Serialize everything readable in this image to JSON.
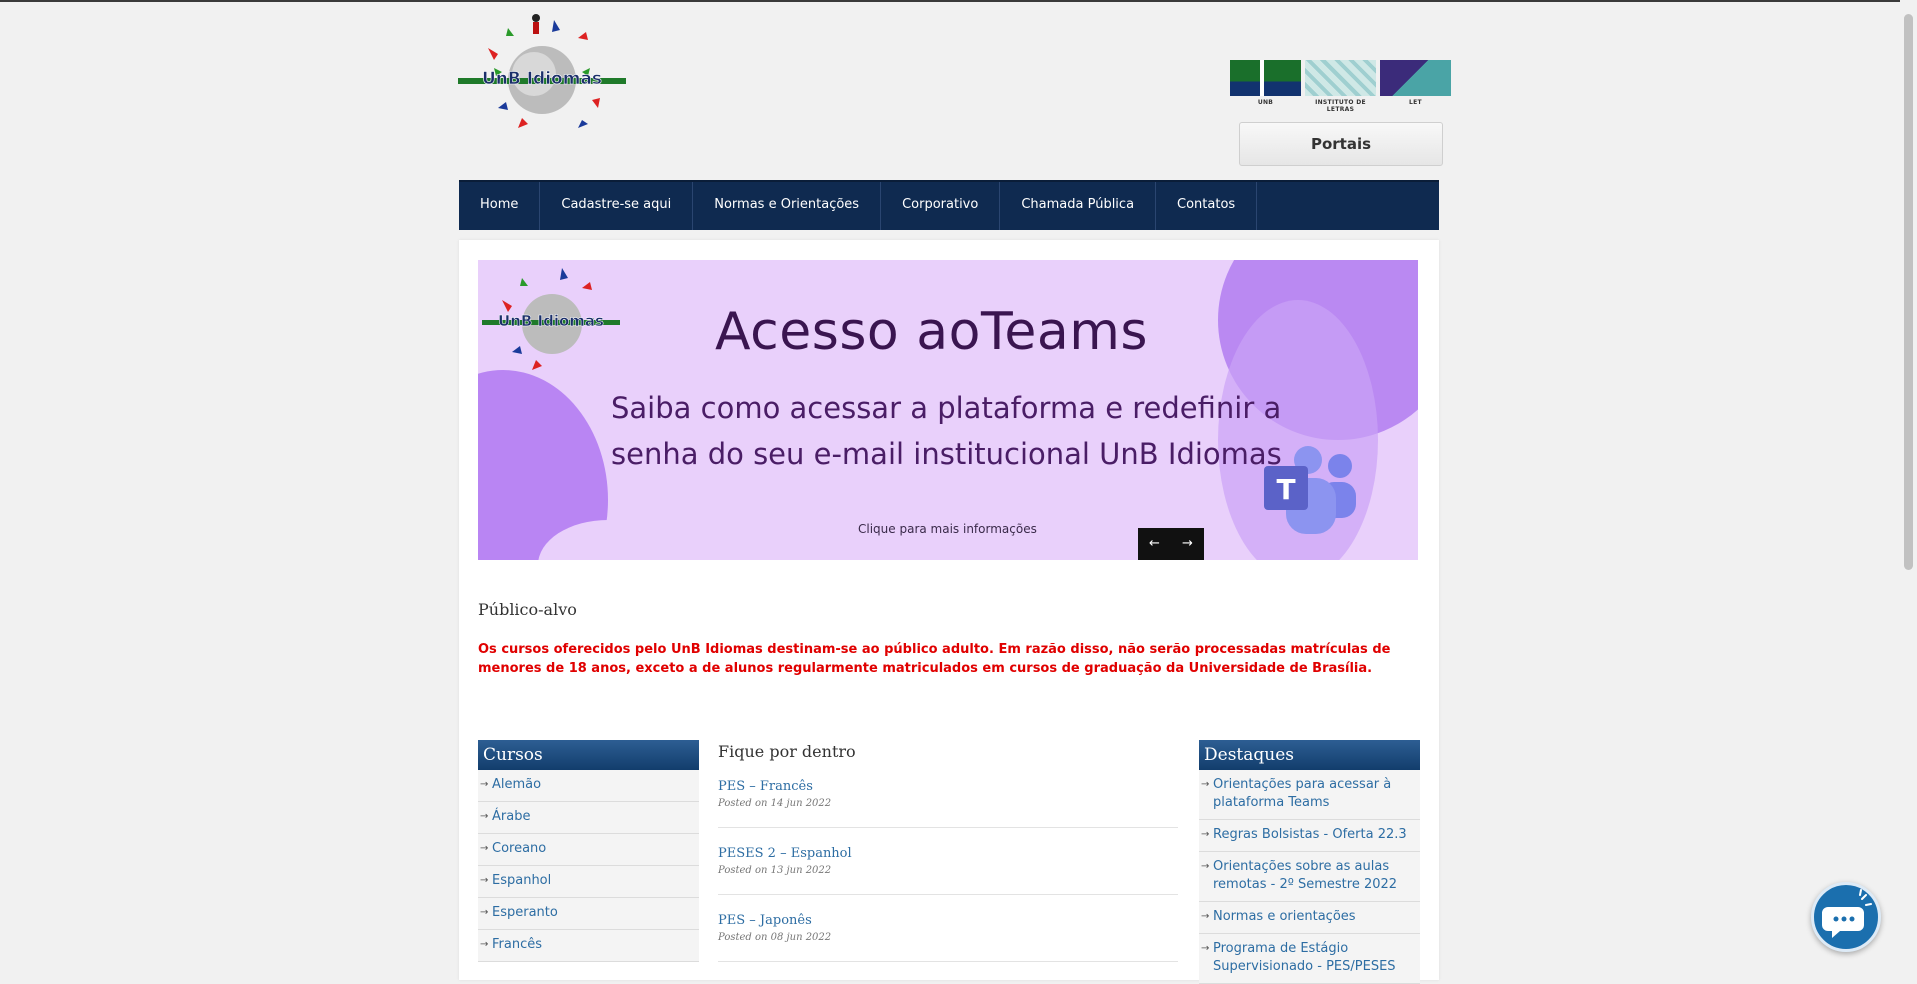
{
  "header": {
    "logo_text": "UnB Idiomas",
    "partner_captions": [
      "UNB",
      "INSTITUTO DE LETRAS",
      "LET"
    ],
    "portais_label": "Portais"
  },
  "nav": {
    "items": [
      "Home",
      "Cadastre-se aqui",
      "Normas e Orientações",
      "Corporativo",
      "Chamada Pública",
      "Contatos"
    ]
  },
  "banner": {
    "title": "Acesso aoTeams",
    "subtitle": "Saiba como acessar a plataforma e redefinir a senha do seu e-mail institucional UnB Idiomas",
    "cta": "Clique para mais informações",
    "prev": "←",
    "next": "→"
  },
  "publico": {
    "title": "Público-alvo",
    "text": "Os cursos oferecidos pelo UnB Idiomas destinam-se ao público adulto. Em razão disso, não serão processadas matrículas de menores de 18 anos, exceto a de alunos regularmente matriculados em cursos de graduação da Universidade de Brasília."
  },
  "cursos": {
    "title": "Cursos",
    "items": [
      "Alemão",
      "Árabe",
      "Coreano",
      "Espanhol",
      "Esperanto",
      "Francês"
    ]
  },
  "news": {
    "title": "Fique por dentro",
    "posts": [
      {
        "title": "PES – Francês",
        "date": "Posted on 14 jun 2022"
      },
      {
        "title": "PESES 2 – Espanhol",
        "date": "Posted on 13 jun 2022"
      },
      {
        "title": "PES – Japonês",
        "date": "Posted on 08 jun 2022"
      }
    ]
  },
  "destaques": {
    "title": "Destaques",
    "items": [
      "Orientações para acessar à plataforma Teams",
      "Regras Bolsistas - Oferta 22.3",
      "Orientações sobre as aulas remotas - 2º Semestre 2022",
      "Normas e orientações",
      "Programa de Estágio Supervisionado - PES/PESES"
    ]
  },
  "colors": {
    "nav_bg": "#0f2a50",
    "banner_bg": "#e9d0fb",
    "notice_red": "#e00000",
    "link_blue": "#2d6da3"
  }
}
